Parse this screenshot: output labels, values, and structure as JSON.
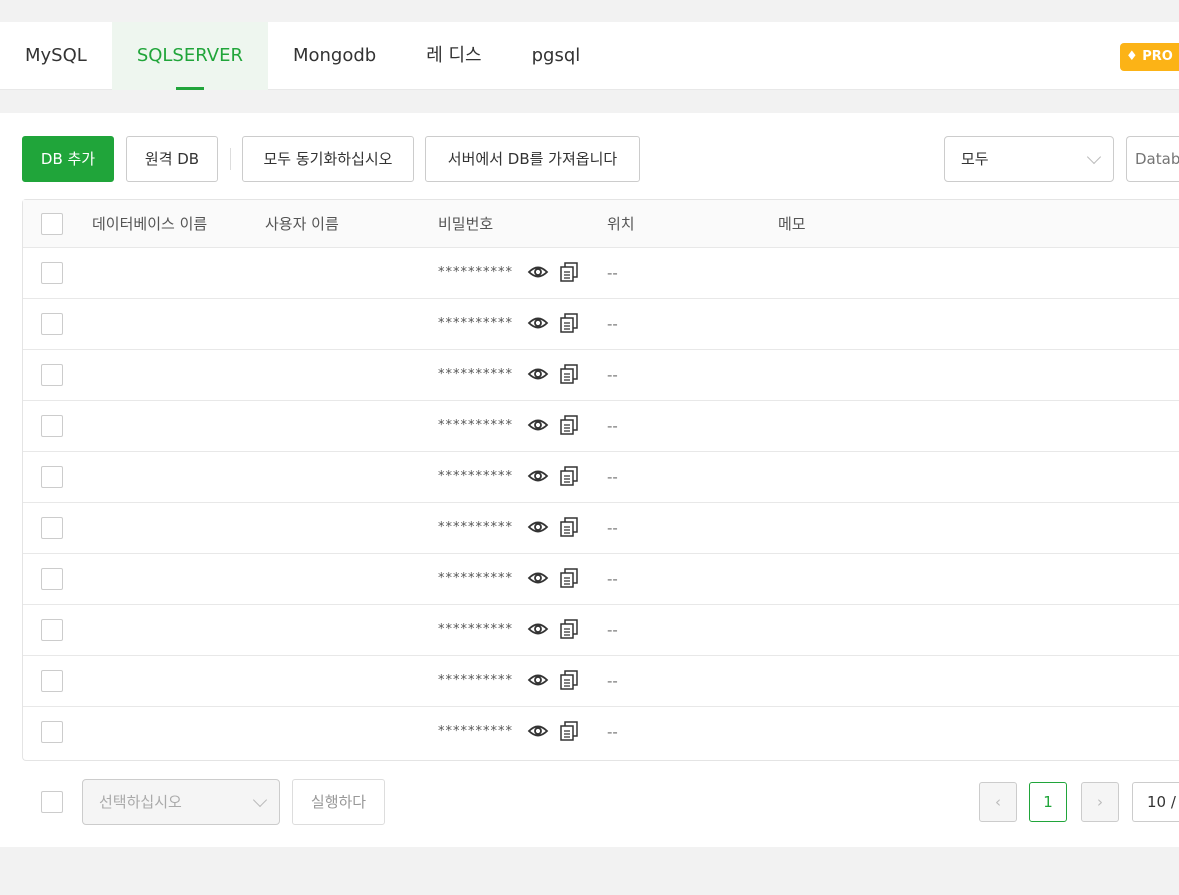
{
  "tabs": [
    "MySQL",
    "SQLSERVER",
    "Mongodb",
    "레 디스",
    "pgsql"
  ],
  "active_tab": 1,
  "pro_badge": "PRO",
  "toolbar": {
    "add_db": "DB 추가",
    "remote_db": "원격 DB",
    "sync_all": "모두 동기화하십시오",
    "import_from_server": "서버에서 DB를 가져옵니다",
    "filter_value": "모두",
    "search_placeholder": "Database"
  },
  "table": {
    "headers": [
      "데이터베이스 이름",
      "사용자 이름",
      "비밀번호",
      "위치",
      "메모"
    ],
    "rows": [
      {
        "password": "**********",
        "location": "--"
      },
      {
        "password": "**********",
        "location": "--"
      },
      {
        "password": "**********",
        "location": "--"
      },
      {
        "password": "**********",
        "location": "--"
      },
      {
        "password": "**********",
        "location": "--"
      },
      {
        "password": "**********",
        "location": "--"
      },
      {
        "password": "**********",
        "location": "--"
      },
      {
        "password": "**********",
        "location": "--"
      },
      {
        "password": "**********",
        "location": "--"
      },
      {
        "password": "**********",
        "location": "--"
      }
    ]
  },
  "footer": {
    "batch_select_placeholder": "선택하십시오",
    "run": "실행하다",
    "prev": "‹",
    "current_page": "1",
    "next": "›",
    "page_size": "10 /"
  }
}
